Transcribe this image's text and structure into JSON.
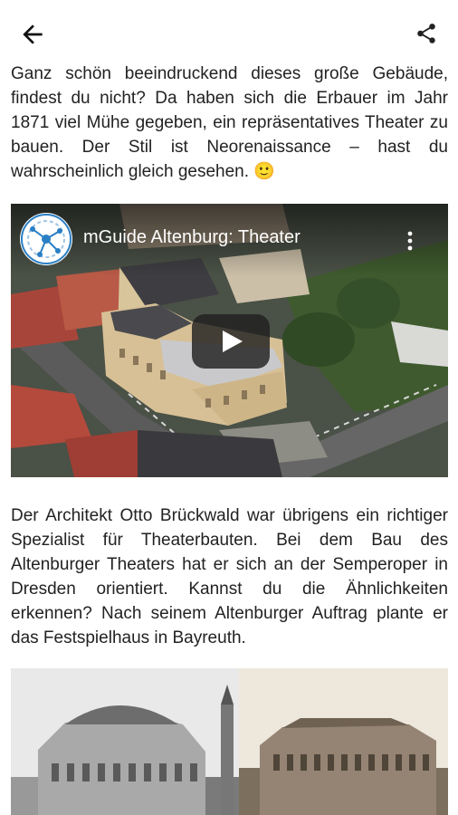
{
  "appbar": {
    "back_icon": "arrow-left-icon",
    "share_icon": "share-icon"
  },
  "paragraphs": {
    "p1": "Ganz schön beeindruckend dieses große Gebäude, findest du nicht? Da haben sich die Erbauer im Jahr 1871 viel Mühe gegeben, ein repräsentatives Theater zu bauen. Der Stil ist Neorenaissance – hast du wahrscheinlich gleich gesehen. 🙂",
    "p2": "Der Architekt Otto Brückwald war übrigens ein richtiger Spezialist für Theaterbauten. Bei dem Bau des Altenburger Theaters hat er sich an der Semperoper in Dresden orientiert. Kannst du die Ähnlichkeiten erkennen? Nach seinem Altenburger Auftrag plante er das Festspielhaus in Bayreuth."
  },
  "video": {
    "title": "mGuide Altenburg: Theater",
    "play_icon": "play-icon",
    "menu_icon": "more-vertical-icon",
    "channel_icon": "mguide-logo-icon",
    "colors": {
      "play_bg": "#212121",
      "logo_blue": "#2a7fc4"
    }
  }
}
